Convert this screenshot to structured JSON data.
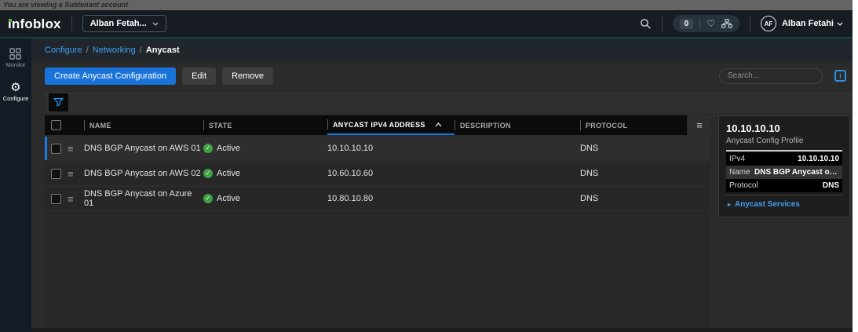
{
  "banner": {
    "text": "You are viewing a Subtenant account"
  },
  "header": {
    "logo": "infoblox",
    "account_switcher": "Alban Fetah...",
    "notification_count": "0",
    "user_initials": "AF",
    "user_name": "Alban Fetahi"
  },
  "sidebar": {
    "items": [
      {
        "label": "Monitor",
        "icon": "grid-icon"
      },
      {
        "label": "Configure",
        "icon": "gear-icon",
        "active": true
      }
    ]
  },
  "breadcrumb": {
    "items": [
      "Configure",
      "Networking",
      "Anycast"
    ],
    "separator": "/"
  },
  "toolbar": {
    "create_label": "Create Anycast Configuration",
    "edit_label": "Edit",
    "remove_label": "Remove",
    "search_placeholder": "Search..."
  },
  "table": {
    "columns": [
      "NAME",
      "STATE",
      "ANYCAST IPV4 ADDRESS",
      "DESCRIPTION",
      "PROTOCOL"
    ],
    "sorted_column": "ANYCAST IPV4 ADDRESS",
    "sort_direction": "ascending",
    "rows": [
      {
        "name": "DNS BGP Anycast on AWS 01",
        "state": "Active",
        "ipv4": "10.10.10.10",
        "description": "",
        "protocol": "DNS",
        "selected": true
      },
      {
        "name": "DNS BGP Anycast on AWS 02",
        "state": "Active",
        "ipv4": "10.60.10.60",
        "description": "",
        "protocol": "DNS",
        "selected": false
      },
      {
        "name": "DNS BGP Anycast on Azure 01",
        "state": "Active",
        "ipv4": "10.80.10.80",
        "description": "",
        "protocol": "DNS",
        "selected": false
      }
    ]
  },
  "detail_panel": {
    "title": "10.10.10.10",
    "subtitle": "Anycast Config Profile",
    "fields": [
      {
        "label": "IPv4",
        "value": "10.10.10.10"
      },
      {
        "label": "Name",
        "value": "DNS BGP Anycast on A..."
      },
      {
        "label": "Protocol",
        "value": "DNS"
      }
    ],
    "link": "Anycast Services"
  },
  "colors": {
    "accent_blue": "#1a73d9",
    "link_blue": "#3f9ff2",
    "active_green": "#3fa144",
    "logo_green": "#58bf3e",
    "banner_gray": "#646464",
    "header_bg": "#171c22",
    "sidebar_bg": "#141b26"
  }
}
